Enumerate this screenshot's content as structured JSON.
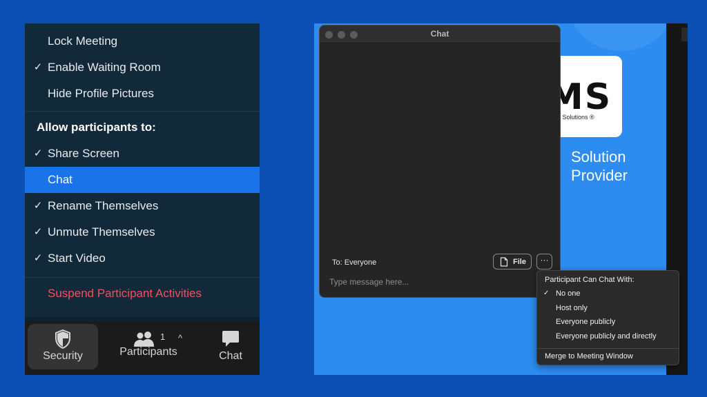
{
  "security_menu": {
    "items_top": [
      {
        "label": "Lock Meeting",
        "checked": false
      },
      {
        "label": "Enable Waiting Room",
        "checked": true
      },
      {
        "label": "Hide Profile Pictures",
        "checked": false
      }
    ],
    "allow_heading": "Allow participants to:",
    "allow_items": [
      {
        "label": "Share Screen",
        "checked": true,
        "active": false
      },
      {
        "label": "Chat",
        "checked": false,
        "active": true
      },
      {
        "label": "Rename Themselves",
        "checked": true,
        "active": false
      },
      {
        "label": "Unmute Themselves",
        "checked": true,
        "active": false
      },
      {
        "label": "Start Video",
        "checked": true,
        "active": false
      }
    ],
    "suspend_label": "Suspend Participant Activities",
    "check_glyph": "✓"
  },
  "toolbar": {
    "security_label": "Security",
    "participants_label": "Participants",
    "participants_count": "1",
    "caret": "^",
    "chat_label": "Chat"
  },
  "chat_window": {
    "title": "Chat",
    "to_label": "To: Everyone",
    "file_label": "File",
    "more_label": "···",
    "placeholder": "Type message here..."
  },
  "chat_menu": {
    "heading": "Participant Can Chat With:",
    "options": [
      {
        "label": "No one",
        "checked": true
      },
      {
        "label": "Host only",
        "checked": false
      },
      {
        "label": "Everyone publicly",
        "checked": false
      },
      {
        "label": "Everyone publicly and directly",
        "checked": false
      }
    ],
    "merge_label": "Merge to Meeting Window",
    "check_glyph": "✓"
  },
  "background": {
    "logo_text": "MS",
    "logo_subtext": "edia Solutions ®",
    "provider_line1": "Solution",
    "provider_line2": "Provider"
  },
  "colors": {
    "page_bg": "#0b4fb3",
    "menu_bg": "#12293a",
    "accent": "#1a73e8",
    "danger": "#f0525b",
    "chat_bg": "#252525",
    "right_bg": "#2d8cf0"
  }
}
